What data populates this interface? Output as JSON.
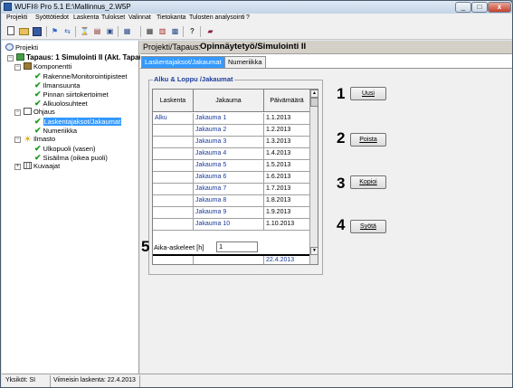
{
  "window": {
    "title": "WUFI® Pro 5.1    E:\\Mallinnus_2.W5P",
    "min": "_",
    "max": "□",
    "close": "x"
  },
  "menu": [
    "Projekti",
    "Syöttötiedot",
    "Laskenta",
    "Tulokset",
    "Valinnat",
    "Tietokanta",
    "Tulosten analysointi",
    "?"
  ],
  "tree": {
    "root": "Projekti",
    "case": "Tapaus: 1 Simulointi II (Akt. Tapau",
    "components": "Komponentti",
    "items": {
      "structure": "Rakenne/Monitorointipisteet",
      "orientation": "Ilmansuunta",
      "surface": "Pinnan siirtokertoimet",
      "initial": "Alkuolosuhteet",
      "control": "Ohjaus",
      "calc_periods": "Laskentajaksot/Jakaumat",
      "numerics": "Numeriikka",
      "climate": "Ilmasto",
      "outside": "Ulkopuoli (vasen)",
      "inside": "Sisäilma (oikea puoli)",
      "graphs": "Kuvaajat"
    }
  },
  "main": {
    "crumb": "Projekti/Tapaus:",
    "crumb_value": "Opinnäytetyö/Simulointi II",
    "tabs": [
      "Laskentajaksot/Jakaumat",
      "Numeriikka"
    ],
    "group_title": "Alku & Loppu /Jakaumat",
    "grid": {
      "headers": [
        "Laskenta",
        "Jakauma",
        "Päivämäärä"
      ],
      "rows": [
        [
          "Alku",
          "Jakauma 1",
          "1.1.2013"
        ],
        [
          "",
          "Jakauma 2",
          "1.2.2013"
        ],
        [
          "",
          "Jakauma 3",
          "1.3.2013"
        ],
        [
          "",
          "Jakauma 4",
          "1.4.2013"
        ],
        [
          "",
          "Jakauma 5",
          "1.5.2013"
        ],
        [
          "",
          "Jakauma 6",
          "1.6.2013"
        ],
        [
          "",
          "Jakauma 7",
          "1.7.2013"
        ],
        [
          "",
          "Jakauma 8",
          "1.8.2013"
        ],
        [
          "",
          "Jakauma 9",
          "1.9.2013"
        ],
        [
          "",
          "Jakauma 10",
          "1.10.2013"
        ]
      ],
      "footer_date": "22.4.2013"
    },
    "buttons": {
      "new": "Uusi",
      "delete": "Poista",
      "copy": "Kopioi",
      "input": "Syötä"
    },
    "callouts": [
      "1",
      "2",
      "3",
      "4",
      "5"
    ],
    "timestep_label": "Aika-askeleet [h]",
    "timestep_value": "1"
  },
  "status": {
    "units": "Yksiköt: SI",
    "last_calc": "Viimeisin laskenta: 22.4.2013"
  }
}
